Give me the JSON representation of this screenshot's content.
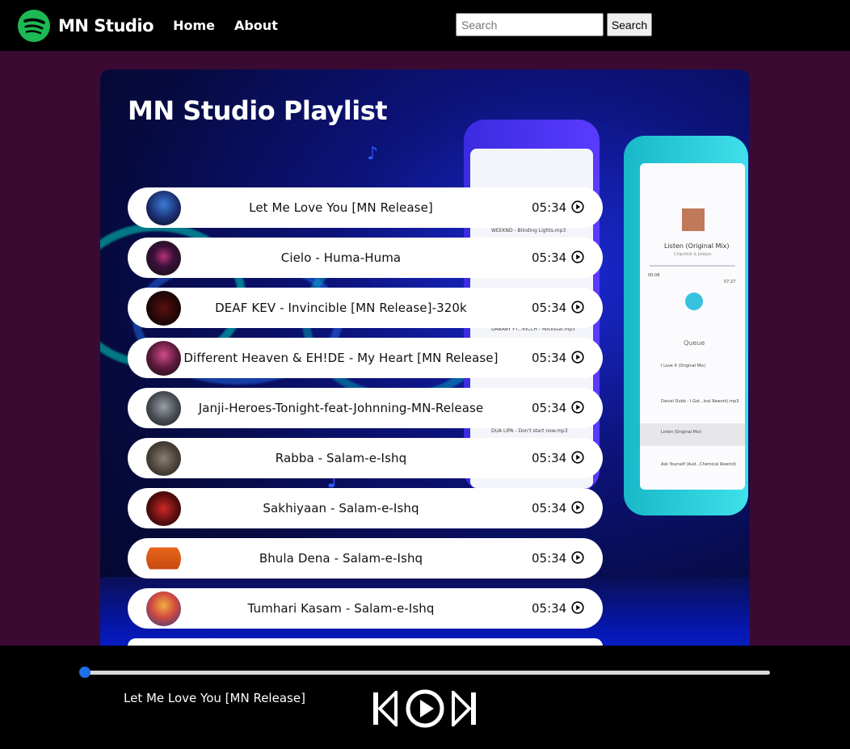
{
  "navbar": {
    "brand": "MN Studio",
    "links": [
      "Home",
      "About"
    ],
    "search_placeholder": "Search",
    "search_button": "Search"
  },
  "playlist": {
    "title": "MN Studio Playlist",
    "songs": [
      {
        "title": "Let Me Love You [MN Release]",
        "duration": "05:34"
      },
      {
        "title": "Cielo - Huma-Huma",
        "duration": "05:34"
      },
      {
        "title": "DEAF KEV - Invincible [MN Release]-320k",
        "duration": "05:34"
      },
      {
        "title": "Different Heaven & EH!DE - My Heart [MN Release]",
        "duration": "05:34"
      },
      {
        "title": "Janji-Heroes-Tonight-feat-Johnning-MN-Release",
        "duration": "05:34"
      },
      {
        "title": "Rabba - Salam-e-Ishq",
        "duration": "05:34"
      },
      {
        "title": "Sakhiyaan - Salam-e-Ishq",
        "duration": "05:34"
      },
      {
        "title": "Bhula Dena - Salam-e-Ishq",
        "duration": "05:34"
      },
      {
        "title": "Tumhari Kasam - Salam-e-Ishq",
        "duration": "05:34"
      }
    ]
  },
  "phone_mockup": {
    "back_rows": [
      "WEEKND - Blinding Lights.mp3",
      "DABABY FT...RICCH - Rockstar.mp3",
      "DUA LIPA - Don't start now.mp3"
    ],
    "track_title": "Listen (Original Mix)",
    "track_artist": "Chipstick & Jolejon",
    "time_start": "00:08",
    "time_end": "07:27",
    "queue_label": "Queue",
    "queue": [
      "I Love It (Original Mix)",
      "Daniel Dubb - I Got...inal Rework).mp3",
      "Listen (Original Mix)",
      "Ask Yourself (Aud...Chemical Rewind)"
    ]
  },
  "player": {
    "now_playing": "Let Me Love You [MN Release]",
    "progress": 0.0
  },
  "colors": {
    "navbar_bg": "#000000",
    "page_bg": "#3a0a33",
    "accent": "#1e6fe8",
    "brand_green": "#1db954"
  },
  "icons": [
    "spotify-logo-icon",
    "play-circle-icon",
    "previous-icon",
    "play-icon",
    "next-icon"
  ]
}
